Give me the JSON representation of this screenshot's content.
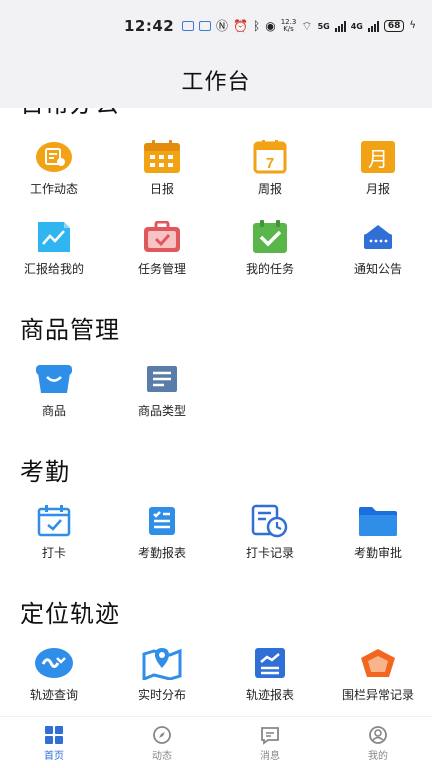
{
  "status": {
    "time": "12:42",
    "speed_value": "12.3",
    "speed_unit": "K/s",
    "net1": "5G",
    "net2": "4G",
    "battery": "68"
  },
  "header": {
    "title": "工作台"
  },
  "sections": [
    {
      "title": "日常办公",
      "items": [
        {
          "label": "工作动态",
          "icon": "work-dynamics-icon"
        },
        {
          "label": "日报",
          "icon": "daily-report-calendar-icon"
        },
        {
          "label": "周报",
          "icon": "weekly-report-calendar-icon",
          "icon_text": "7"
        },
        {
          "label": "月报",
          "icon": "monthly-report-icon",
          "icon_text": "月"
        },
        {
          "label": "汇报给我的",
          "icon": "report-to-me-chart-icon"
        },
        {
          "label": "任务管理",
          "icon": "task-management-briefcase-icon"
        },
        {
          "label": "我的任务",
          "icon": "my-tasks-check-icon"
        },
        {
          "label": "通知公告",
          "icon": "notice-icon"
        }
      ]
    },
    {
      "title": "商品管理",
      "items": [
        {
          "label": "商品",
          "icon": "goods-basket-icon"
        },
        {
          "label": "商品类型",
          "icon": "goods-type-list-icon"
        }
      ]
    },
    {
      "title": "考勤",
      "items": [
        {
          "label": "打卡",
          "icon": "clock-in-calendar-icon"
        },
        {
          "label": "考勤报表",
          "icon": "attendance-report-icon"
        },
        {
          "label": "打卡记录",
          "icon": "clock-in-record-icon"
        },
        {
          "label": "考勤审批",
          "icon": "attendance-approval-folder-icon"
        }
      ]
    },
    {
      "title": "定位轨迹",
      "items": [
        {
          "label": "轨迹查询",
          "icon": "track-query-icon"
        },
        {
          "label": "实时分布",
          "icon": "realtime-map-icon"
        },
        {
          "label": "轨迹报表",
          "icon": "track-report-icon"
        },
        {
          "label": "围栏异常记录",
          "icon": "fence-exception-icon"
        }
      ]
    }
  ],
  "tabs": [
    {
      "label": "首页",
      "icon": "home-grid-icon",
      "active": true
    },
    {
      "label": "动态",
      "icon": "compass-icon",
      "active": false
    },
    {
      "label": "消息",
      "icon": "message-icon",
      "active": false
    },
    {
      "label": "我的",
      "icon": "profile-icon",
      "active": false
    }
  ],
  "colors": {
    "accent": "#2f6fd6",
    "orange": "#f2a215",
    "green": "#5ab54b",
    "red": "#e0585b"
  }
}
